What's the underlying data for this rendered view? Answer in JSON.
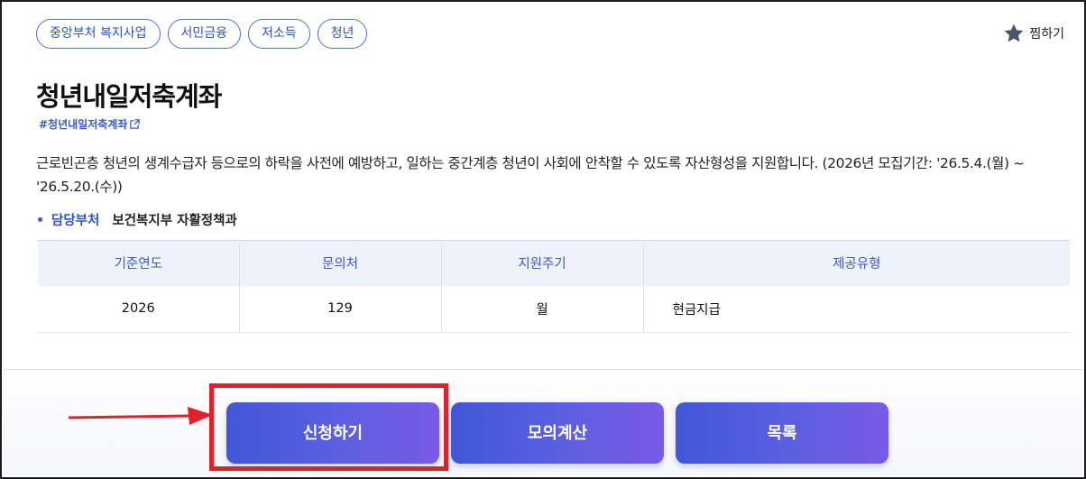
{
  "tags": [
    "중앙부처 복지사업",
    "서민금융",
    "저소득",
    "청년"
  ],
  "favorite": {
    "label": "찜하기",
    "icon": "star-icon"
  },
  "title": "청년내일저축계좌",
  "hashtag": "#청년내일저축계좌",
  "description": "근로빈곤층 청년의 생계수급자 등으로의 하락을 사전에 예방하고, 일하는 중간계층 청년이 사회에 안착할 수 있도록 자산형성을 지원합니다. (2026년 모집기간: '26.5.4.(월) ~ '26.5.20.(수))",
  "department": {
    "label": "담당부처",
    "value": "보건복지부 자활정책과"
  },
  "info_table": {
    "headers": [
      "기준연도",
      "문의처",
      "지원주기",
      "제공유형"
    ],
    "row": [
      "2026",
      "129",
      "월",
      "현금지급"
    ]
  },
  "buttons": {
    "apply": "신청하기",
    "calc": "모의계산",
    "list": "목록"
  },
  "colors": {
    "accent": "#3b5cc4",
    "highlight": "#e0202a",
    "button_start": "#3f57d8",
    "button_end": "#7a5ae6"
  }
}
